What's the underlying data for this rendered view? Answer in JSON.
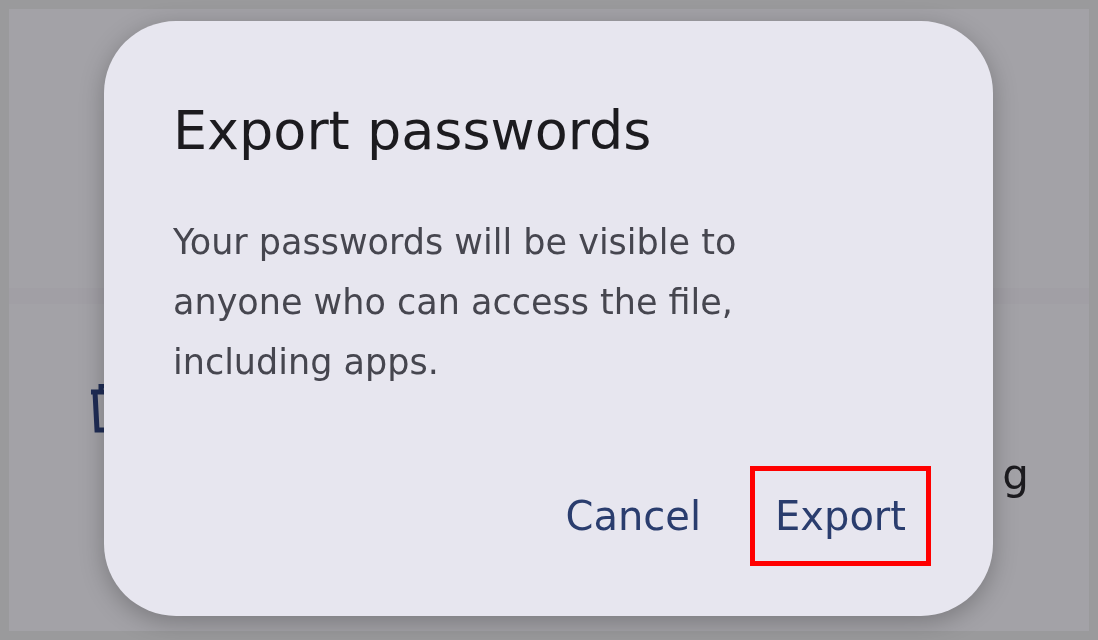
{
  "background": {
    "row_text": "g"
  },
  "dialog": {
    "title": "Export passwords",
    "message": "Your passwords will be visible to anyone who can access the file, including apps.",
    "actions": [
      {
        "label": "Cancel",
        "highlighted": false
      },
      {
        "label": "Export",
        "highlighted": true
      }
    ]
  }
}
